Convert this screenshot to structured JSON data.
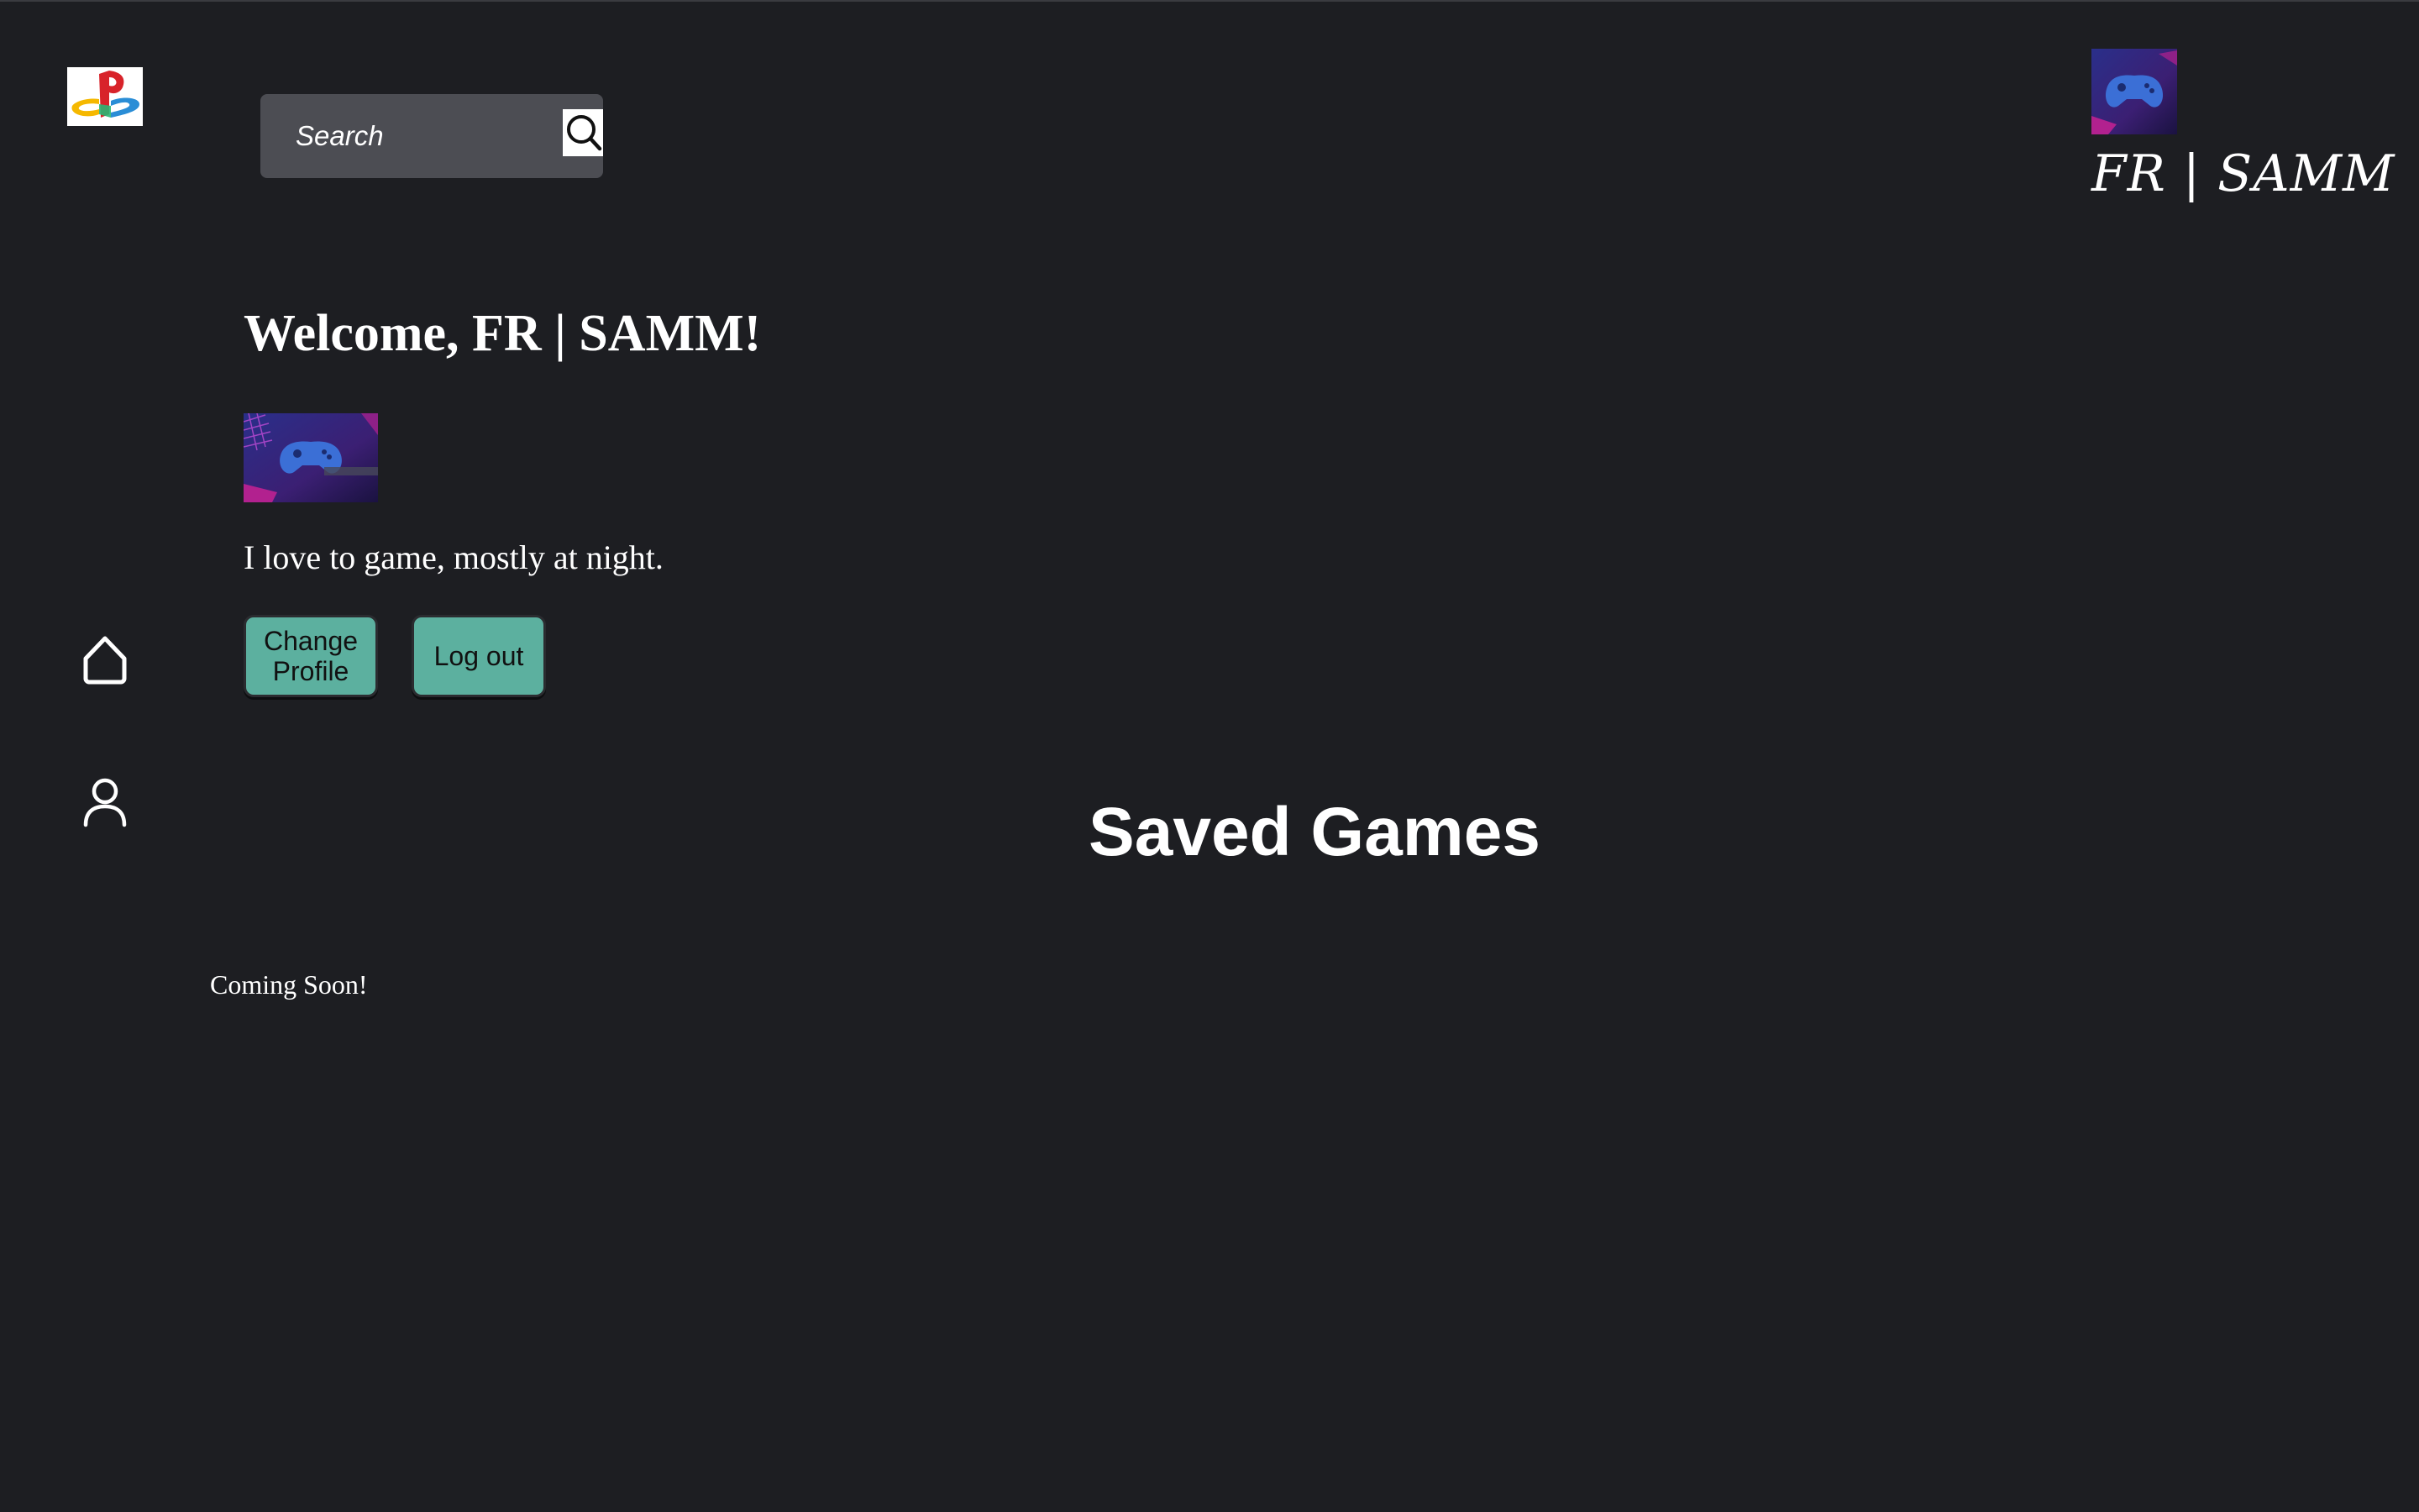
{
  "sidebar": {
    "logo_icon": "playstation-logo-icon",
    "items": [
      {
        "icon": "home-icon"
      },
      {
        "icon": "user-icon"
      }
    ]
  },
  "search": {
    "placeholder": "Search",
    "icon": "search-icon"
  },
  "header": {
    "profile_name": "FR | SAMM",
    "profile_image": "game-controller-thumbnail"
  },
  "profile": {
    "welcome": "Welcome, FR | SAMM!",
    "avatar": "game-controller-image",
    "bio": "I love to game, mostly at night.",
    "change_profile_label": "Change Profile",
    "logout_label": "Log out"
  },
  "saved_games": {
    "title": "Saved Games",
    "status": "Coming Soon!"
  },
  "colors": {
    "background": "#1d1e22",
    "button": "#5cb09f",
    "search_bg": "#4c4d53"
  }
}
